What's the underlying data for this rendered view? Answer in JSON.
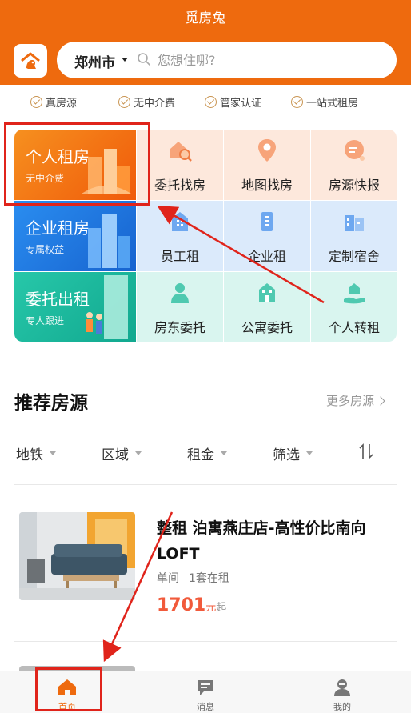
{
  "app": {
    "title": "觅房兔"
  },
  "header": {
    "city": "郑州市",
    "search_placeholder": "您想住哪?"
  },
  "features": [
    "真房源",
    "无中介费",
    "管家认证",
    "一站式租房"
  ],
  "categories": {
    "big": [
      {
        "title": "个人租房",
        "subtitle": "无中介费",
        "color": "#f47a14"
      },
      {
        "title": "企业租房",
        "subtitle": "专属权益",
        "color": "#1f7ae0"
      },
      {
        "title": "委托出租",
        "subtitle": "专人跟进",
        "color": "#18b9a2"
      }
    ],
    "cells": [
      {
        "label": "委托找房",
        "icon": "house-search-icon"
      },
      {
        "label": "地图找房",
        "icon": "map-pin-icon"
      },
      {
        "label": "房源快报",
        "icon": "message-icon"
      },
      {
        "label": "员工租",
        "icon": "building-icon"
      },
      {
        "label": "企业租",
        "icon": "office-icon"
      },
      {
        "label": "定制宿舍",
        "icon": "dorm-icon"
      },
      {
        "label": "房东委托",
        "icon": "landlord-icon"
      },
      {
        "label": "公寓委托",
        "icon": "apartment-icon"
      },
      {
        "label": "个人转租",
        "icon": "hand-house-icon"
      }
    ]
  },
  "recommend": {
    "title": "推荐房源",
    "more": "更多房源"
  },
  "filters": [
    "地铁",
    "区域",
    "租金",
    "筛选"
  ],
  "listing": {
    "title": "整租 泊寓燕庄店-高性价比南向LOFT",
    "meta_type": "单间",
    "meta_stock": "1套在租",
    "price": "1701",
    "price_unit": "元",
    "price_suffix": "起"
  },
  "tabs": [
    {
      "label": "首页",
      "active": true
    },
    {
      "label": "消息",
      "active": false
    },
    {
      "label": "我的",
      "active": false
    }
  ],
  "colors": {
    "brand": "#ee6a0e",
    "price": "#f15a3b",
    "annotation": "#e0241b"
  }
}
